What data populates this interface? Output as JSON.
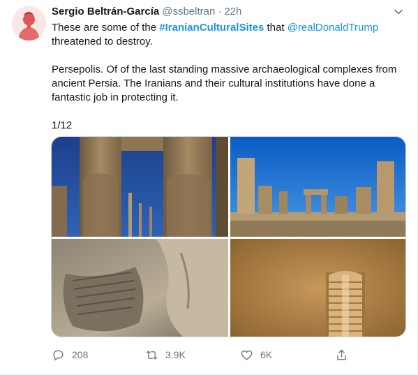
{
  "tweet": {
    "author_name": "Sergio Beltrán-García",
    "author_handle": "@ssbeltran",
    "separator": "·",
    "time": "22h",
    "text": {
      "line1_pre": "These are some of the ",
      "hashtag": "#IranianCulturalSites",
      "line1_mid": " that ",
      "mention": "@realDonaldTrump",
      "line1_post": " threatened to destroy.",
      "paragraph2": "Persepolis. Of of the last standing massive archaeological complexes from ancient Persia. The Iranians and their cultural institutions have done a fantastic job in protecting it.",
      "counter": "1/12"
    },
    "media": [
      {
        "icon": "photo-gate-of-nations"
      },
      {
        "icon": "photo-persepolis-ruins"
      },
      {
        "icon": "photo-stone-relief"
      },
      {
        "icon": "photo-doorway-stairs"
      }
    ],
    "actions": {
      "reply_count": "208",
      "retweet_count": "3.9K",
      "like_count": "6K"
    }
  },
  "colors": {
    "link": "#1b95e0",
    "muted": "#657786",
    "text": "#14171a"
  }
}
